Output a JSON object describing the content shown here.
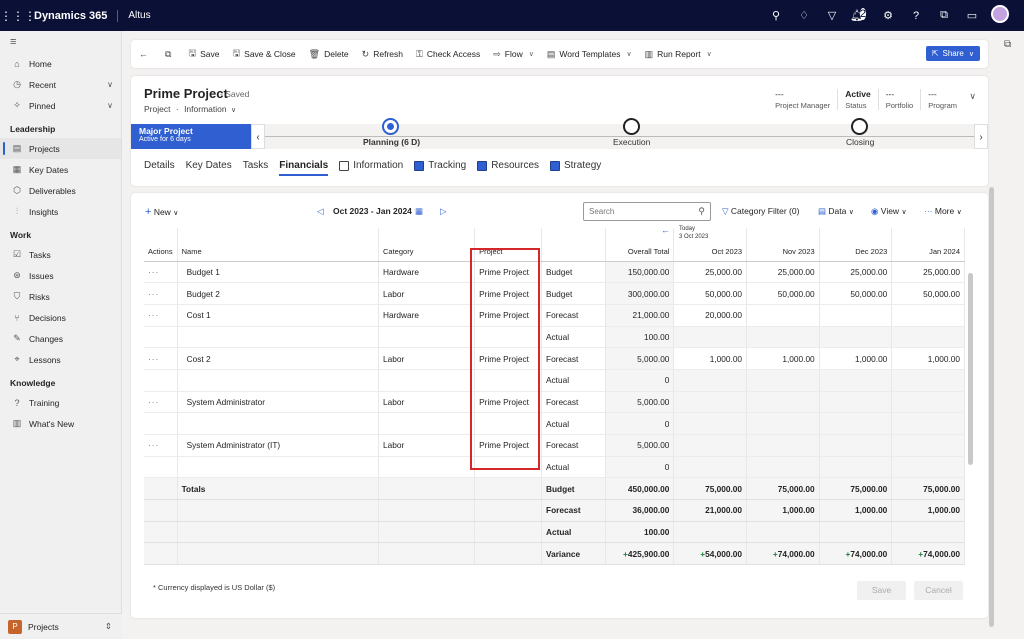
{
  "app": {
    "name": "Dynamics 365",
    "env": "Altus",
    "notif_count": "2"
  },
  "nav": {
    "top": [
      {
        "label": "Home"
      },
      {
        "label": "Recent"
      },
      {
        "label": "Pinned"
      }
    ],
    "sections": [
      {
        "header": "Leadership",
        "items": [
          {
            "label": "Projects"
          },
          {
            "label": "Key Dates"
          },
          {
            "label": "Deliverables"
          },
          {
            "label": "Insights"
          }
        ]
      },
      {
        "header": "Work",
        "items": [
          {
            "label": "Tasks"
          },
          {
            "label": "Issues"
          },
          {
            "label": "Risks"
          },
          {
            "label": "Decisions"
          },
          {
            "label": "Changes"
          },
          {
            "label": "Lessons"
          }
        ]
      },
      {
        "header": "Knowledge",
        "items": [
          {
            "label": "Training"
          },
          {
            "label": "What's New"
          }
        ]
      }
    ],
    "area": {
      "letter": "P",
      "label": "Projects"
    }
  },
  "commands": {
    "save": "Save",
    "save_close": "Save & Close",
    "delete": "Delete",
    "refresh": "Refresh",
    "check_access": "Check Access",
    "flow": "Flow",
    "word_templates": "Word Templates",
    "run_report": "Run Report",
    "share": "Share"
  },
  "record": {
    "title": "Prime Project",
    "saved": "- Saved",
    "entity": "Project",
    "form": "Information",
    "fields": [
      {
        "value": "---",
        "label": "Project Manager"
      },
      {
        "value": "Active",
        "label": "Status"
      },
      {
        "value": "---",
        "label": "Portfolio"
      },
      {
        "value": "---",
        "label": "Program"
      }
    ]
  },
  "bpf": {
    "stage_name": "Major Project",
    "stage_active": "Active for 6 days",
    "stages": [
      "Planning  (6 D)",
      "Execution",
      "Closing"
    ]
  },
  "tabs": [
    "Details",
    "Key Dates",
    "Tasks",
    "Financials",
    "Information",
    "Tracking",
    "Resources",
    "Strategy"
  ],
  "toolbar": {
    "new": "New",
    "range": "Oct 2023 - Jan 2024",
    "search_placeholder": "Search",
    "category_filter": "Category Filter (0)",
    "data": "Data",
    "view": "View",
    "more": "More"
  },
  "today": {
    "label": "Today",
    "date": "3 Oct 2023"
  },
  "columns": {
    "actions": "Actions",
    "name": "Name",
    "category": "Category",
    "project": "Project",
    "type": "",
    "overall": "Overall Total",
    "months": [
      "Oct 2023",
      "Nov 2023",
      "Dec 2023",
      "Jan 2024"
    ]
  },
  "rows": [
    {
      "actions": "···",
      "name": "Budget 1",
      "category": "Hardware",
      "project": "Prime Project",
      "type": "Budget",
      "overall": "150,000.00",
      "m": [
        "25,000.00",
        "25,000.00",
        "25,000.00",
        "25,000.00"
      ]
    },
    {
      "actions": "···",
      "name": "Budget 2",
      "category": "Labor",
      "project": "Prime Project",
      "type": "Budget",
      "overall": "300,000.00",
      "m": [
        "50,000.00",
        "50,000.00",
        "50,000.00",
        "50,000.00"
      ]
    },
    {
      "actions": "···",
      "name": "Cost 1",
      "category": "Hardware",
      "project": "Prime Project",
      "type": "Forecast",
      "overall": "21,000.00",
      "m": [
        "20,000.00",
        "",
        "",
        ""
      ]
    },
    {
      "actions": "",
      "name": "",
      "category": "",
      "project": "",
      "type": "Actual",
      "overall": "100.00",
      "m": [
        "",
        "",
        "",
        ""
      ]
    },
    {
      "actions": "···",
      "name": "Cost 2",
      "category": "Labor",
      "project": "Prime Project",
      "type": "Forecast",
      "overall": "5,000.00",
      "m": [
        "1,000.00",
        "1,000.00",
        "1,000.00",
        "1,000.00"
      ]
    },
    {
      "actions": "",
      "name": "",
      "category": "",
      "project": "",
      "type": "Actual",
      "overall": "0",
      "m": [
        "",
        "",
        "",
        ""
      ]
    },
    {
      "actions": "···",
      "name": "System Administrator",
      "category": "Labor",
      "project": "Prime Project",
      "type": "Forecast",
      "overall": "5,000.00",
      "m": [
        "",
        "",
        "",
        ""
      ]
    },
    {
      "actions": "",
      "name": "",
      "category": "",
      "project": "",
      "type": "Actual",
      "overall": "0",
      "m": [
        "",
        "",
        "",
        ""
      ]
    },
    {
      "actions": "···",
      "name": "System Administrator (IT)",
      "category": "Labor",
      "project": "Prime Project",
      "type": "Forecast",
      "overall": "5,000.00",
      "m": [
        "",
        "",
        "",
        ""
      ]
    },
    {
      "actions": "",
      "name": "",
      "category": "",
      "project": "",
      "type": "Actual",
      "overall": "0",
      "m": [
        "",
        "",
        "",
        ""
      ]
    }
  ],
  "totals": [
    {
      "label": "Totals",
      "type": "Budget",
      "overall": "450,000.00",
      "m": [
        "75,000.00",
        "75,000.00",
        "75,000.00",
        "75,000.00"
      ]
    },
    {
      "label": "",
      "type": "Forecast",
      "overall": "36,000.00",
      "m": [
        "21,000.00",
        "1,000.00",
        "1,000.00",
        "1,000.00"
      ]
    },
    {
      "label": "",
      "type": "Actual",
      "overall": "100.00",
      "m": [
        "",
        "",
        "",
        ""
      ]
    },
    {
      "label": "",
      "type": "Variance",
      "overall": "425,900.00",
      "m": [
        "54,000.00",
        "74,000.00",
        "74,000.00",
        "74,000.00"
      ],
      "sign": "+"
    }
  ],
  "footer": {
    "note": "* Currency displayed is US Dollar ($)",
    "save": "Save",
    "cancel": "Cancel"
  }
}
